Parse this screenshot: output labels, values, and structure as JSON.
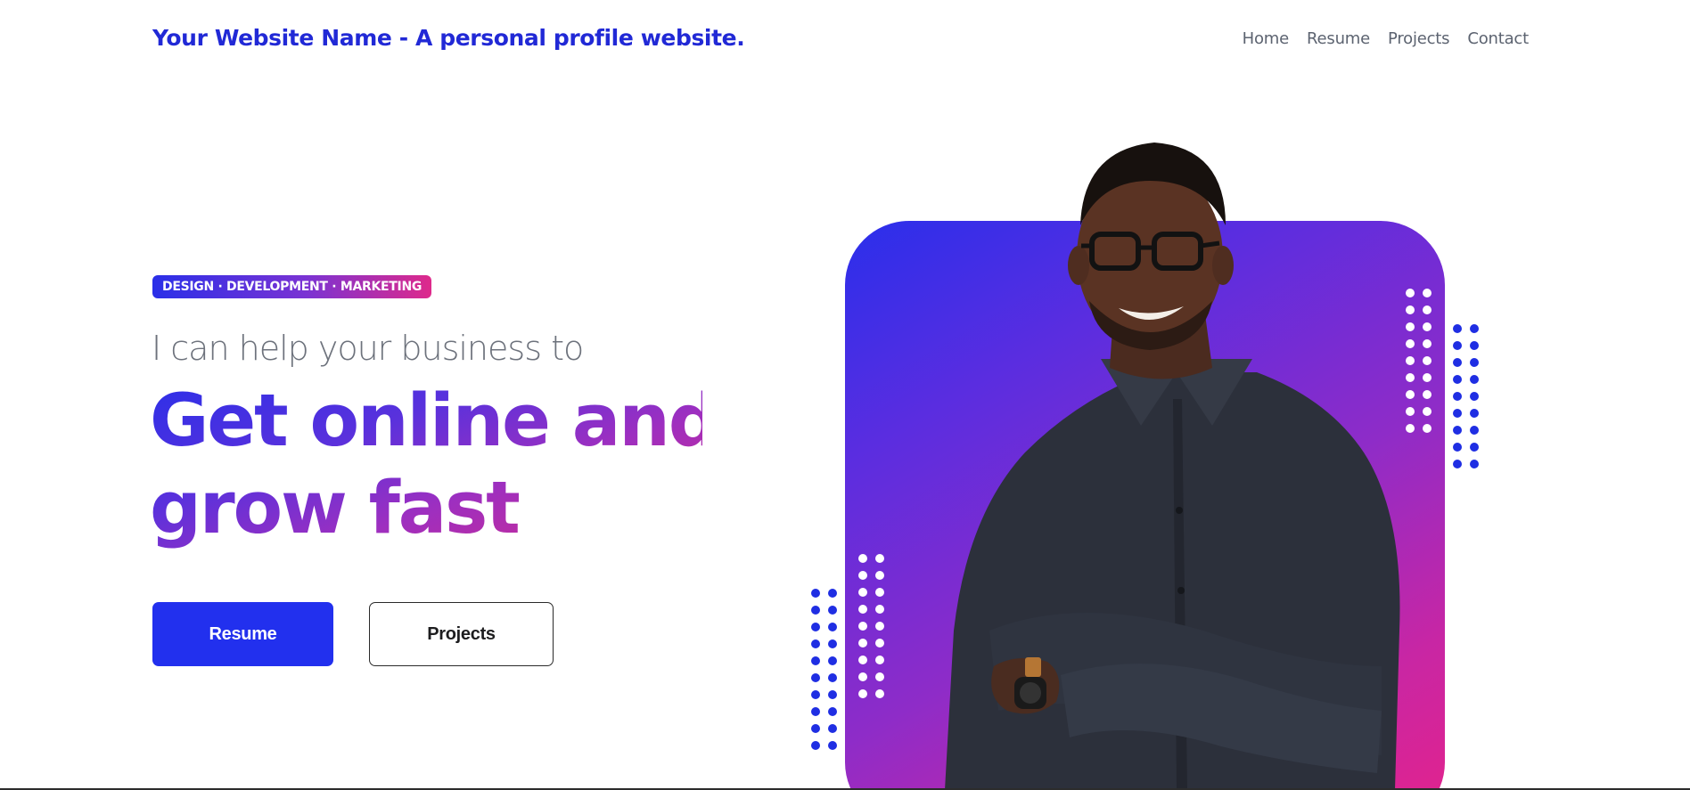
{
  "header": {
    "brand": "Your Website Name - A personal profile website.",
    "nav": [
      {
        "label": "Home"
      },
      {
        "label": "Resume"
      },
      {
        "label": "Projects"
      },
      {
        "label": "Contact"
      }
    ]
  },
  "hero": {
    "badge": "DESIGN · DEVELOPMENT · MARKETING",
    "tagline": "I can help your business to",
    "headline_line1": "Get online and",
    "headline_line2": "grow fast",
    "primary_button": "Resume",
    "secondary_button": "Projects"
  },
  "colors": {
    "brand_blue": "#2129d6",
    "button_blue": "#2230ee",
    "gradient_start": "#2a2feb",
    "gradient_end": "#e4238b",
    "nav_text": "#5c6370"
  },
  "icons": {
    "person_image": "smiling-man-portrait"
  }
}
